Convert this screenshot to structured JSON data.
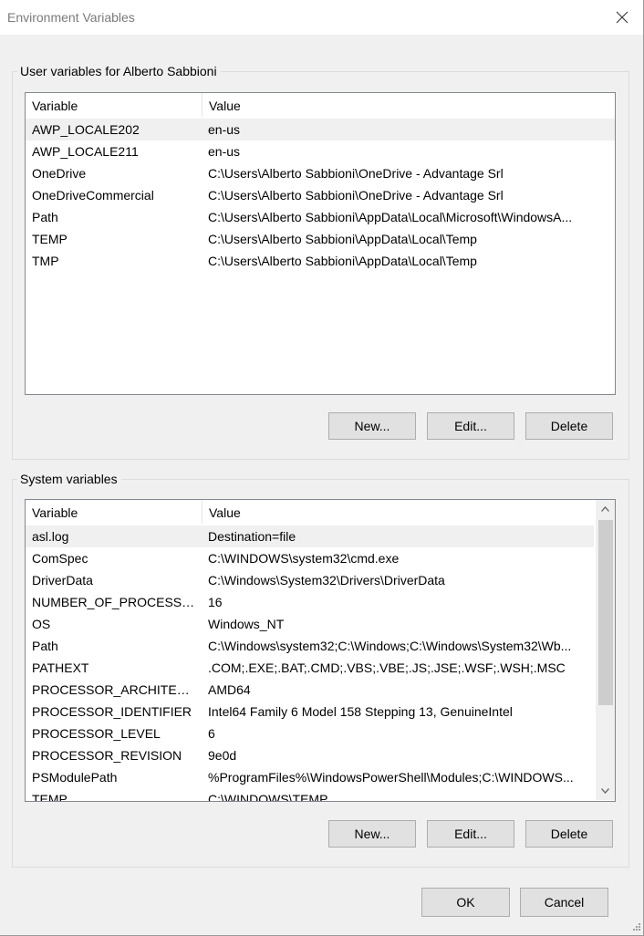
{
  "window": {
    "title": "Environment Variables"
  },
  "user_group": {
    "label": "User variables for Alberto Sabbioni",
    "columns": {
      "variable": "Variable",
      "value": "Value"
    },
    "rows": [
      {
        "variable": "AWP_LOCALE202",
        "value": "en-us",
        "selected": true
      },
      {
        "variable": "AWP_LOCALE211",
        "value": "en-us"
      },
      {
        "variable": "OneDrive",
        "value": "C:\\Users\\Alberto Sabbioni\\OneDrive - Advantage Srl"
      },
      {
        "variable": "OneDriveCommercial",
        "value": "C:\\Users\\Alberto Sabbioni\\OneDrive - Advantage Srl"
      },
      {
        "variable": "Path",
        "value": "C:\\Users\\Alberto Sabbioni\\AppData\\Local\\Microsoft\\WindowsA..."
      },
      {
        "variable": "TEMP",
        "value": "C:\\Users\\Alberto Sabbioni\\AppData\\Local\\Temp"
      },
      {
        "variable": "TMP",
        "value": "C:\\Users\\Alberto Sabbioni\\AppData\\Local\\Temp"
      }
    ],
    "buttons": {
      "new": "New...",
      "edit": "Edit...",
      "delete": "Delete"
    }
  },
  "system_group": {
    "label": "System variables",
    "columns": {
      "variable": "Variable",
      "value": "Value"
    },
    "rows": [
      {
        "variable": "asl.log",
        "value": "Destination=file",
        "selected": true
      },
      {
        "variable": "ComSpec",
        "value": "C:\\WINDOWS\\system32\\cmd.exe"
      },
      {
        "variable": "DriverData",
        "value": "C:\\Windows\\System32\\Drivers\\DriverData"
      },
      {
        "variable": "NUMBER_OF_PROCESSORS",
        "value": "16"
      },
      {
        "variable": "OS",
        "value": "Windows_NT"
      },
      {
        "variable": "Path",
        "value": "C:\\Windows\\system32;C:\\Windows;C:\\Windows\\System32\\Wb..."
      },
      {
        "variable": "PATHEXT",
        "value": ".COM;.EXE;.BAT;.CMD;.VBS;.VBE;.JS;.JSE;.WSF;.WSH;.MSC"
      },
      {
        "variable": "PROCESSOR_ARCHITECTU...",
        "value": "AMD64"
      },
      {
        "variable": "PROCESSOR_IDENTIFIER",
        "value": "Intel64 Family 6 Model 158 Stepping 13, GenuineIntel"
      },
      {
        "variable": "PROCESSOR_LEVEL",
        "value": "6"
      },
      {
        "variable": "PROCESSOR_REVISION",
        "value": "9e0d"
      },
      {
        "variable": "PSModulePath",
        "value": "%ProgramFiles%\\WindowsPowerShell\\Modules;C:\\WINDOWS..."
      },
      {
        "variable": "TEMP",
        "value": "C:\\WINDOWS\\TEMP"
      }
    ],
    "buttons": {
      "new": "New...",
      "edit": "Edit...",
      "delete": "Delete"
    }
  },
  "footer": {
    "ok": "OK",
    "cancel": "Cancel"
  },
  "icons": {
    "close": "close-icon",
    "scroll_up": "chevron-up-icon",
    "scroll_down": "chevron-down-icon",
    "resize": "resize-grip-icon"
  },
  "colors": {
    "selected_row": "#f0f0f0",
    "button_bg": "#e1e1e1",
    "list_border": "#828790"
  }
}
